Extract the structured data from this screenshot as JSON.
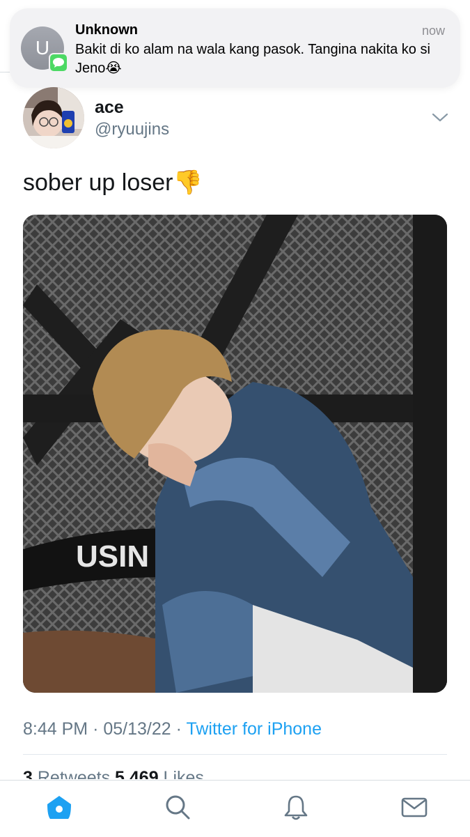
{
  "notification": {
    "avatar_initial": "U",
    "sender": "Unknown",
    "time": "now",
    "message": "Bakit di ko alam na wala kang pasok. Tangina nakita ko si Jeno😭",
    "badge_icon": "messages-icon",
    "badge_color": "#4cd964"
  },
  "tweet": {
    "display_name": "ace",
    "handle": "@ryuujins",
    "text": "sober up loser👎",
    "media_text": "USIN",
    "time": "8:44 PM",
    "date": "05/13/22",
    "source": "Twitter for iPhone",
    "separator": "·",
    "retweets_count": "3",
    "retweets_label": "Retweets",
    "likes_count": "5,469",
    "likes_label": "Likes"
  },
  "tabbar": {
    "items": [
      {
        "icon": "home-icon",
        "active": true
      },
      {
        "icon": "search-icon",
        "active": false
      },
      {
        "icon": "bell-icon",
        "active": false
      },
      {
        "icon": "mail-icon",
        "active": false
      }
    ],
    "active_color": "#1da1f2",
    "inactive_color": "#657786"
  }
}
